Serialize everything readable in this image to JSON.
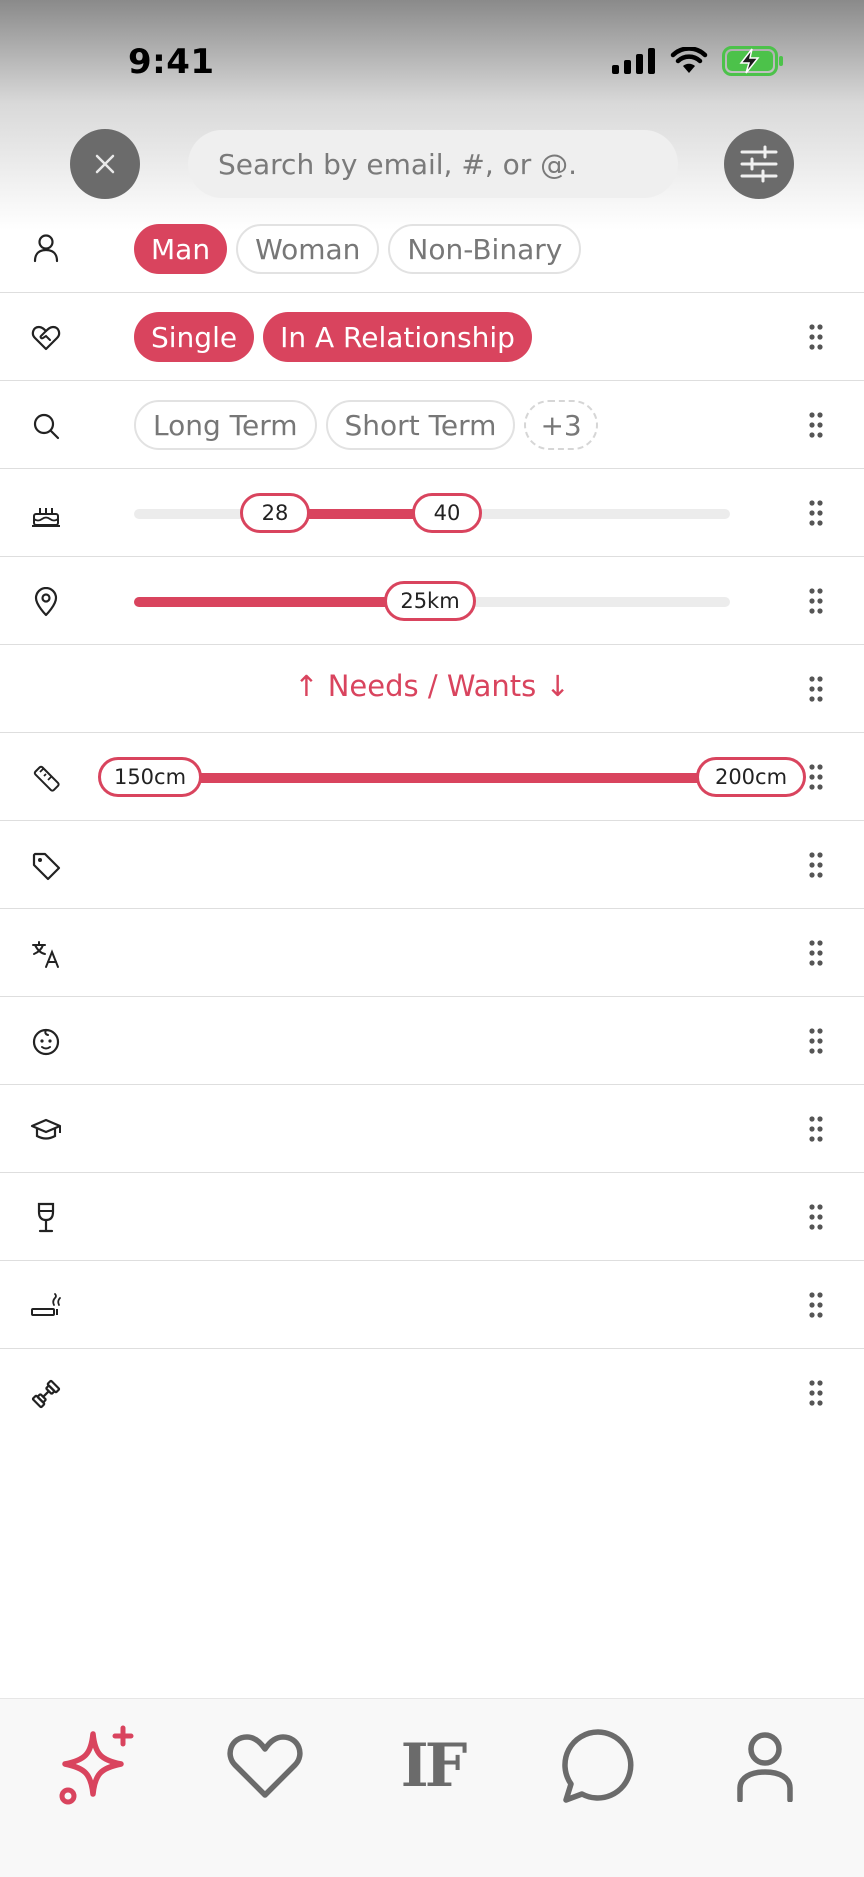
{
  "status_bar": {
    "time": "9:41"
  },
  "search": {
    "placeholder": "Search by email, #, or @."
  },
  "filters": {
    "gender": {
      "chips": [
        "Man",
        "Woman",
        "Non-Binary"
      ],
      "selected": [
        "Man"
      ]
    },
    "relationship": {
      "chips": [
        "Single",
        "In A Relationship"
      ],
      "selected": [
        "Single",
        "In A Relationship"
      ]
    },
    "looking_for": {
      "chips": [
        "Long Term",
        "Short Term"
      ],
      "more": "+3"
    },
    "age": {
      "min_label": "28",
      "max_label": "40",
      "min": 28,
      "max": 40
    },
    "distance": {
      "label": "25km",
      "value_fraction": 0.5
    },
    "section_divider": "↑ Needs / Wants ↓",
    "height": {
      "min_label": "150cm",
      "max_label": "200cm"
    }
  },
  "colors": {
    "accent": "#d9445e",
    "chip_border": "#e2e2e2",
    "icon_gray": "#6b6b6b"
  },
  "tabbar": {
    "logo": "IF"
  }
}
